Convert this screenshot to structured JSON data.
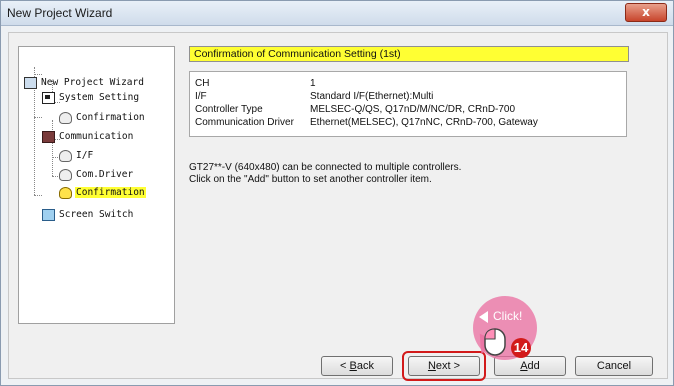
{
  "window": {
    "title": "New Project Wizard",
    "close_label": "x"
  },
  "tree": {
    "items": [
      {
        "label": "New Project Wizard",
        "icon": "project-icon"
      },
      {
        "label": "System Setting",
        "icon": "network-icon"
      },
      {
        "label": "Confirmation",
        "icon": "bulb-icon"
      },
      {
        "label": "Communication",
        "icon": "communication-icon"
      },
      {
        "label": "I/F",
        "icon": "bulb-icon"
      },
      {
        "label": "Com.Driver",
        "icon": "bulb-icon"
      },
      {
        "label": "Confirmation",
        "icon": "bulb-icon",
        "selected": true
      },
      {
        "label": "Screen Switch",
        "icon": "screen-icon"
      }
    ]
  },
  "main": {
    "header": "Confirmation of Communication Setting (1st)",
    "info": [
      {
        "key": "CH",
        "value": "1"
      },
      {
        "key": "I/F",
        "value": "Standard I/F(Ethernet):Multi"
      },
      {
        "key": "Controller Type",
        "value": "MELSEC-Q/QS, Q17nD/M/NC/DR, CRnD-700"
      },
      {
        "key": "Communication Driver",
        "value": "Ethernet(MELSEC), Q17nNC, CRnD-700, Gateway"
      }
    ],
    "message_line1": "GT27**-V (640x480) can be connected to multiple controllers.",
    "message_line2": "Click on the \"Add\" button to set another controller item."
  },
  "buttons": {
    "back_prefix": "< ",
    "back_mnemonic": "B",
    "back_rest": "ack",
    "next_mnemonic": "N",
    "next_rest": "ext >",
    "add_mnemonic": "A",
    "add_rest": "dd",
    "cancel": "Cancel"
  },
  "annotation": {
    "click_label": "Click!",
    "step_number": "14",
    "highlight_color": "#d21a1a",
    "callout_color": "#eb6ea0"
  },
  "colors": {
    "selection": "#ffff33"
  }
}
